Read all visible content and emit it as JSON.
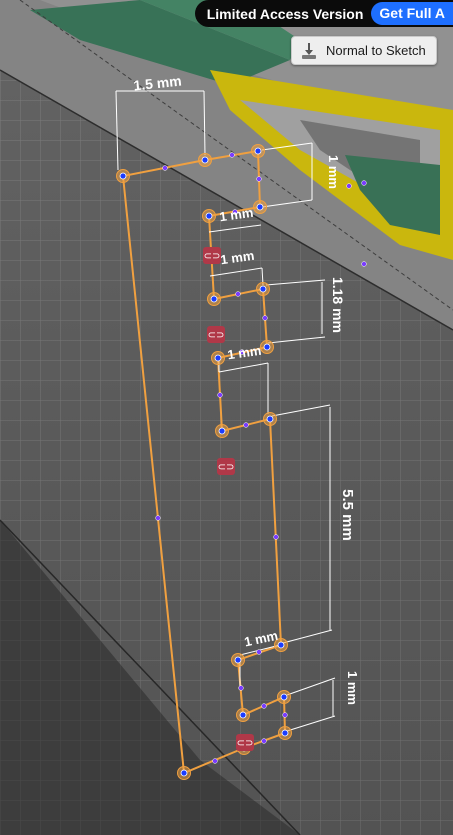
{
  "banner": {
    "label": "Limited Access Version",
    "button": "Get Full A"
  },
  "toolbar": {
    "normal_to_sketch": "Normal to Sketch",
    "normal_to_sketch_icon": "camera-down-icon"
  },
  "dimensions": {
    "top_width": "1.5 mm",
    "top_right_height": "1 mm",
    "tab1_width": "1 mm",
    "tab1_lower_width": "1 mm",
    "tab2_height": "1.18 mm",
    "tab2_width": "1 mm",
    "span_height": "5.5 mm",
    "bottom_tab_width": "1 mm",
    "bottom_tab_height": "1 mm"
  },
  "constraint_icon": "chain-link-icon",
  "colors": {
    "sketch_line": "#f0a040",
    "point": "#1a3cff",
    "constraint_badge": "#b03848",
    "model_green": "#2e6b4e",
    "model_yellow": "#c8b400"
  }
}
